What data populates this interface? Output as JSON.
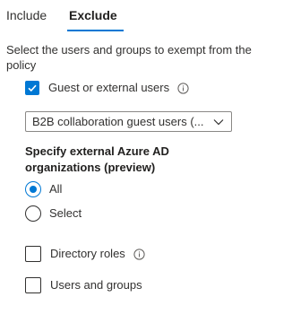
{
  "tabs": [
    {
      "label": "Include",
      "active": false
    },
    {
      "label": "Exclude",
      "active": true
    }
  ],
  "description": "Select the users and groups to exempt from the policy",
  "guest_checkbox": {
    "label": "Guest or external users",
    "checked": true
  },
  "guest_type_dropdown": {
    "value": "B2B collaboration guest users (..."
  },
  "external_orgs": {
    "heading": "Specify external Azure AD organizations (preview)",
    "options": [
      {
        "label": "All",
        "selected": true
      },
      {
        "label": "Select",
        "selected": false
      }
    ]
  },
  "directory_roles_checkbox": {
    "label": "Directory roles",
    "checked": false
  },
  "users_groups_checkbox": {
    "label": "Users and groups",
    "checked": false
  },
  "colors": {
    "accent": "#0078d4",
    "text": "#323130"
  },
  "icons": {
    "info": "info-icon",
    "chevron": "chevron-down-icon",
    "check": "checkmark-icon"
  }
}
